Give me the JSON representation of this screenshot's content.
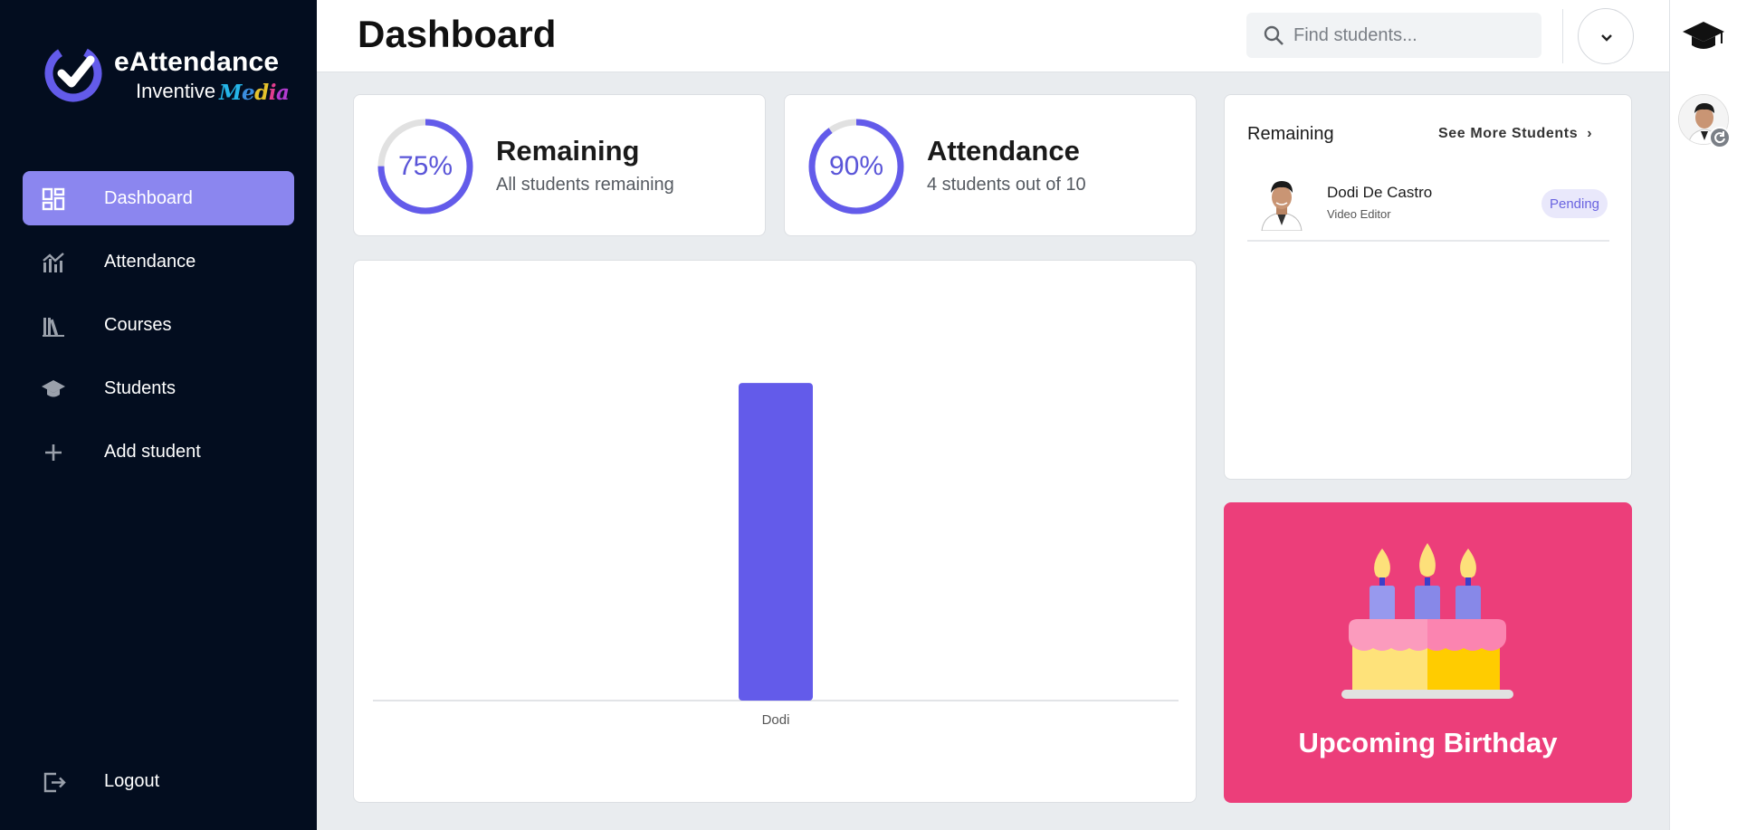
{
  "brand": {
    "title": "eAttendance",
    "subtitle": "Inventive",
    "media_text": "Media"
  },
  "sidebar": {
    "items": [
      {
        "label": "Dashboard",
        "icon": "dashboard-icon",
        "active": true
      },
      {
        "label": "Attendance",
        "icon": "chart-icon",
        "active": false
      },
      {
        "label": "Courses",
        "icon": "library-icon",
        "active": false
      },
      {
        "label": "Students",
        "icon": "graduation-cap-icon",
        "active": false
      },
      {
        "label": "Add student",
        "icon": "plus-icon",
        "active": false
      }
    ],
    "logout": "Logout"
  },
  "header": {
    "title": "Dashboard",
    "search_placeholder": "Find students..."
  },
  "stats": [
    {
      "percent_text": "75%",
      "percent": 75,
      "title": "Remaining",
      "subtitle": "All students remaining"
    },
    {
      "percent_text": "90%",
      "percent": 90,
      "title": "Attendance",
      "subtitle": "4 students out of 10"
    }
  ],
  "remaining_panel": {
    "title": "Remaining",
    "see_more": "See More Students",
    "students": [
      {
        "name": "Dodi De Castro",
        "role": "Video Editor",
        "status": "Pending"
      }
    ]
  },
  "birthday": {
    "title": "Upcoming Birthday"
  },
  "colors": {
    "accent": "#635bea",
    "sidebar_bg": "#030d1f",
    "birthday_bg": "#ec3e7a",
    "nav_active": "#8b86ef"
  },
  "chart_data": {
    "type": "bar",
    "categories": [
      "Dodi"
    ],
    "values": [
      1
    ],
    "title": "",
    "xlabel": "",
    "ylabel": "",
    "ylim": [
      0,
      1.1
    ],
    "grid": false,
    "color": "#635bea"
  }
}
